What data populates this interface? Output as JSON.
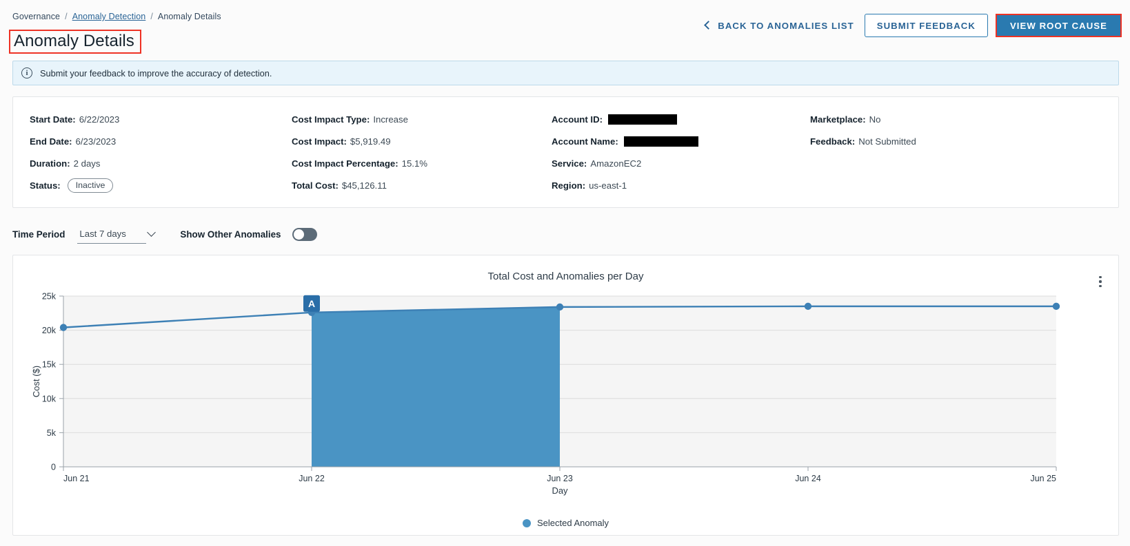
{
  "breadcrumb": {
    "root": "Governance",
    "sep": "/",
    "link": "Anomaly Detection",
    "current": "Anomaly Details"
  },
  "header": {
    "title": "Anomaly Details",
    "back_label": "BACK TO ANOMALIES LIST",
    "submit_feedback_label": "SUBMIT FEEDBACK",
    "view_root_cause_label": "VIEW ROOT CAUSE",
    "accent_blue": "#2a7ab0",
    "link_blue": "#2a6496",
    "annotation_red": "#ee3224"
  },
  "banner": {
    "icon": "info-icon",
    "text": "Submit your feedback to improve the accuracy of detection."
  },
  "details": {
    "col1": [
      {
        "label": "Start Date:",
        "value": "6/22/2023",
        "type": "text"
      },
      {
        "label": "End Date:",
        "value": "6/23/2023",
        "type": "text"
      },
      {
        "label": "Duration:",
        "value": "2 days",
        "type": "text"
      },
      {
        "label": "Status:",
        "value": "Inactive",
        "type": "pill"
      }
    ],
    "col2": [
      {
        "label": "Cost Impact Type:",
        "value": "Increase",
        "type": "text"
      },
      {
        "label": "Cost Impact:",
        "value": "$5,919.49",
        "type": "text"
      },
      {
        "label": "Cost Impact Percentage:",
        "value": "15.1%",
        "type": "text"
      },
      {
        "label": "Total Cost:",
        "value": "$45,126.11",
        "type": "text"
      }
    ],
    "col3": [
      {
        "label": "Account ID:",
        "value": "",
        "type": "redacted-id"
      },
      {
        "label": "Account Name:",
        "value": "",
        "type": "redacted-name"
      },
      {
        "label": "Service:",
        "value": "AmazonEC2",
        "type": "text"
      },
      {
        "label": "Region:",
        "value": "us-east-1",
        "type": "text"
      }
    ],
    "col4": [
      {
        "label": "Marketplace:",
        "value": "No",
        "type": "text"
      },
      {
        "label": "Feedback:",
        "value": "Not Submitted",
        "type": "text"
      }
    ]
  },
  "controls": {
    "time_period_label": "Time Period",
    "time_period_value": "Last 7 days",
    "time_period_options": [
      "Last 7 days"
    ],
    "show_other_label": "Show Other Anomalies",
    "show_other_on": false
  },
  "chart_card": {
    "menu_icon": "kebab-menu-icon"
  },
  "chart_data": {
    "type": "area",
    "title": "Total Cost and Anomalies per Day",
    "xlabel": "Day",
    "ylabel": "Cost ($)",
    "categories": [
      "Jun 21",
      "Jun 22",
      "Jun 23",
      "Jun 24",
      "Jun 25"
    ],
    "series": [
      {
        "name": "Total Cost",
        "values": [
          20400,
          22600,
          23400,
          23500,
          23500
        ]
      }
    ],
    "ylim": [
      0,
      25000
    ],
    "yticks": [
      0,
      5000,
      10000,
      15000,
      20000,
      25000
    ],
    "ytick_labels": [
      "0",
      "5k",
      "10k",
      "15k",
      "20k",
      "25k"
    ],
    "grid": true,
    "legend_position": "bottom",
    "legend": [
      {
        "label": "Selected Anomaly",
        "color": "#4a94c4"
      }
    ],
    "line_color": "#3d80b5",
    "band_color": "#4a94c4",
    "plot_bg": "#f5f5f5",
    "annotations": [
      {
        "label": "A",
        "x": "Jun 22",
        "kind": "anomaly-marker",
        "color": "#2a6ea8"
      }
    ],
    "anomaly_band": {
      "from": "Jun 22",
      "to": "Jun 23"
    }
  }
}
